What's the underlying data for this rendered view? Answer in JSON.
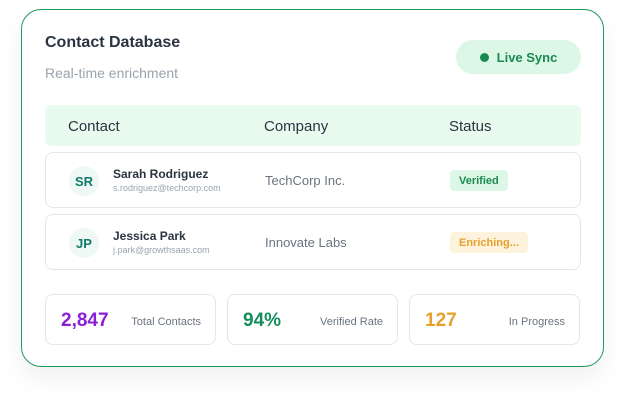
{
  "header": {
    "title": "Contact Database",
    "subtitle": "Real-time enrichment",
    "sync_label": "Live Sync"
  },
  "table": {
    "columns": [
      "Contact",
      "Company",
      "Status"
    ],
    "rows": [
      {
        "initials": "SR",
        "name": "Sarah Rodriguez",
        "email": "s.rodriguez@techcorp.com",
        "company": "TechCorp Inc.",
        "status": "Verified"
      },
      {
        "initials": "JP",
        "name": "Jessica Park",
        "email": "j.park@growthsaas.com",
        "company": "Innovate Labs",
        "status": "Enriching..."
      }
    ]
  },
  "stats": [
    {
      "value": "2,847",
      "label": "Total Contacts",
      "color": "#8a1fd6"
    },
    {
      "value": "94%",
      "label": "Verified Rate",
      "color": "#158e5c"
    },
    {
      "value": "127",
      "label": "In Progress",
      "color": "#e7a12b"
    }
  ],
  "colors": {
    "accent": "#1c9b5e",
    "verified": "#1a8a50",
    "enriching": "#e7a12b"
  }
}
